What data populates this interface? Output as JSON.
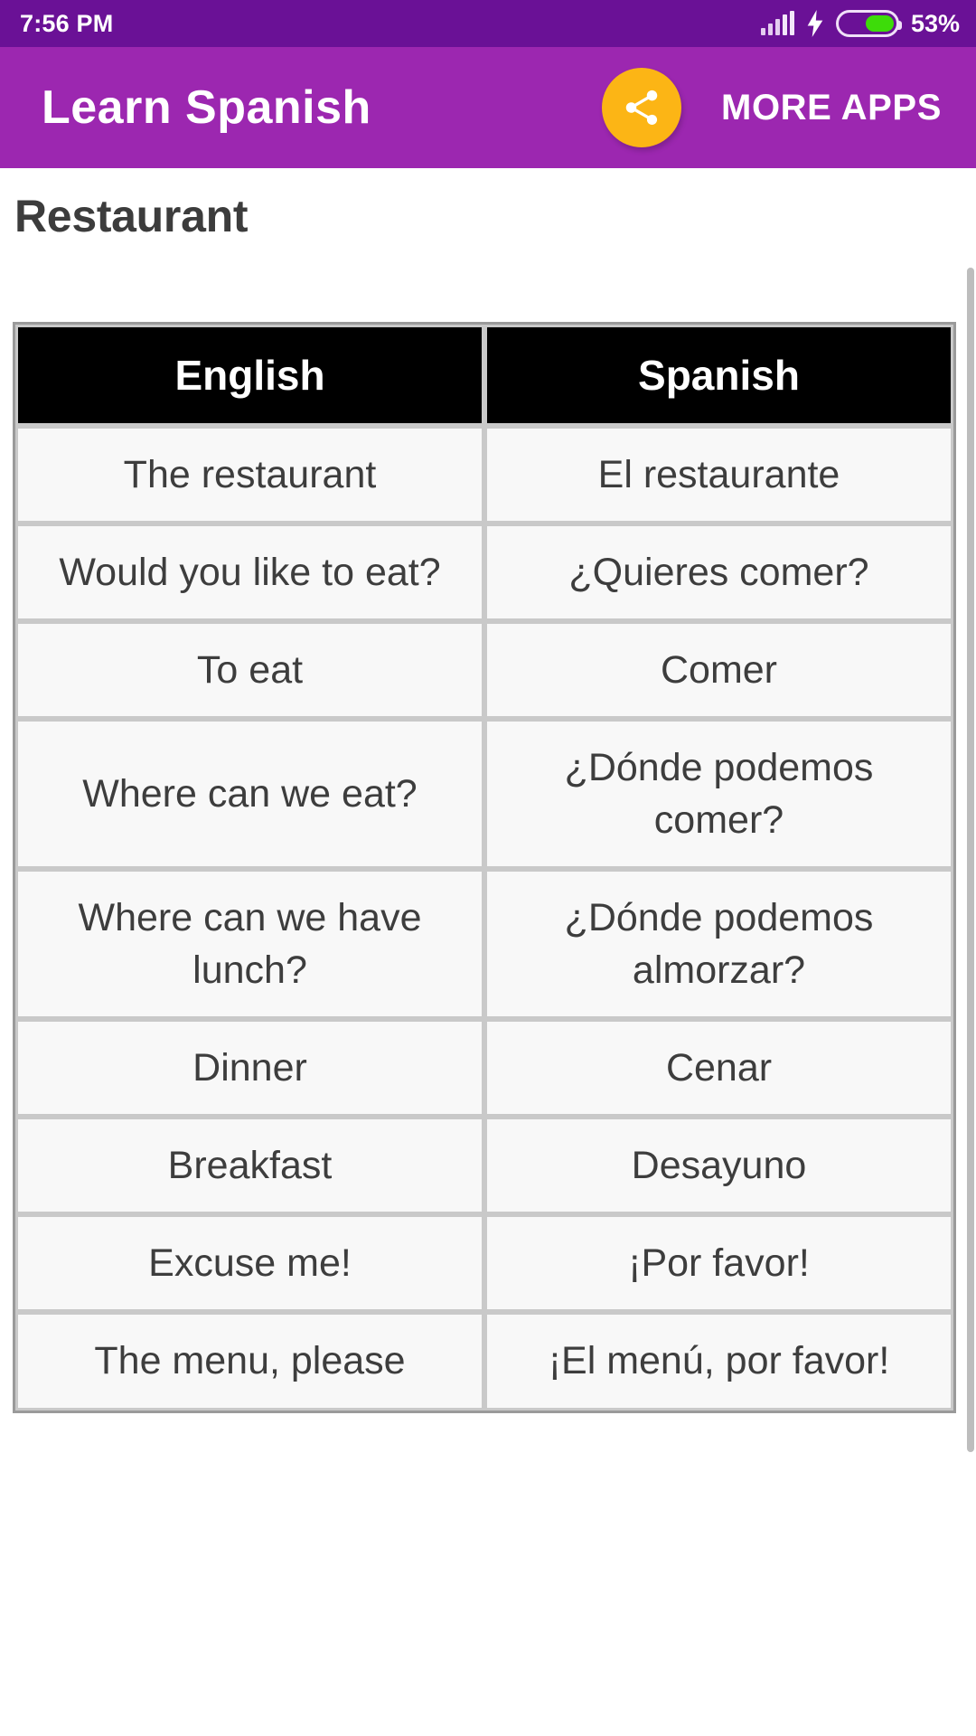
{
  "status_bar": {
    "time": "7:56 PM",
    "battery_percent": "53%",
    "battery_level": 53,
    "signal_icon": "signal-bars-icon",
    "charging_icon": "lightning-bolt-icon",
    "battery_icon": "battery-icon",
    "background_color": "#6a1196",
    "battery_fill_color": "#3ddc09"
  },
  "app_bar": {
    "title": "Learn Spanish",
    "share_icon": "share-icon",
    "more_apps_label": "MORE APPS",
    "background_color": "#9c27b0",
    "share_button_color": "#fcb515"
  },
  "content": {
    "page_title": "Restaurant",
    "table": {
      "headers": [
        "English",
        "Spanish"
      ],
      "rows": [
        [
          "The restaurant",
          "El restaurante"
        ],
        [
          "Would you like to eat?",
          "¿Quieres comer?"
        ],
        [
          "To eat",
          "Comer"
        ],
        [
          "Where can we eat?",
          "¿Dónde podemos comer?"
        ],
        [
          "Where can we have lunch?",
          "¿Dónde podemos almorzar?"
        ],
        [
          "Dinner",
          "Cenar"
        ],
        [
          "Breakfast",
          "Desayuno"
        ],
        [
          "Excuse me!",
          "¡Por favor!"
        ],
        [
          "The menu, please",
          "¡El menú, por favor!"
        ]
      ],
      "header_background": "#000000",
      "header_text_color": "#ffffff",
      "cell_background": "#f8f8f8",
      "cell_text_color": "#3d3d3d",
      "border_color": "#c9c9c9"
    }
  }
}
